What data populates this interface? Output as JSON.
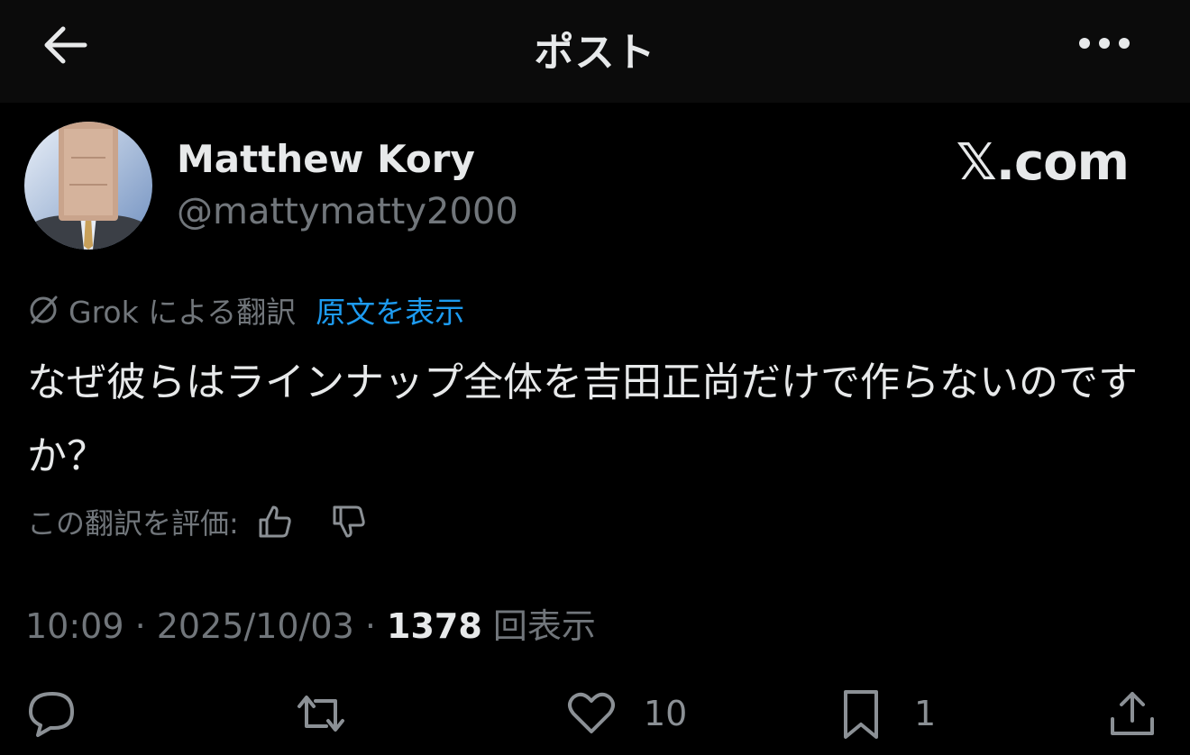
{
  "header": {
    "title": "ポスト",
    "back_icon": "arrow-left-icon",
    "more_icon": "more-horizontal-icon"
  },
  "author": {
    "display_name": "Matthew Kory",
    "handle": "@mattymatty2000"
  },
  "watermark": "𝕏.com",
  "translation": {
    "label": "Grok による翻訳",
    "show_original": "原文を表示",
    "rate_label": "この翻訳を評価:"
  },
  "post": {
    "text": " なぜ彼らはラインナップ全体を吉田正尚だけで作らないのですか？"
  },
  "meta": {
    "time_date": "10:09 · 2025/10/03 · ",
    "views_count": "1378",
    "views_label": " 回表示"
  },
  "actions": {
    "reply_count": "",
    "repost_count": "",
    "like_count": "10",
    "bookmark_count": "1"
  },
  "colors": {
    "background": "#000000",
    "header_bg": "#0b0b0b",
    "text": "#e7e9ea",
    "secondary": "#71767b",
    "link": "#1d9bf0"
  }
}
